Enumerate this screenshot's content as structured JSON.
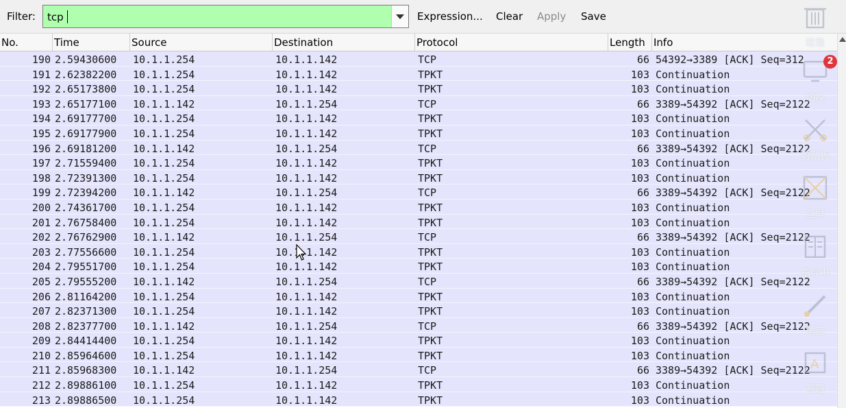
{
  "toolbar": {
    "filter_label": "Filter:",
    "filter_value": "tcp",
    "expression_label": "Expression...",
    "clear_label": "Clear",
    "apply_label": "Apply",
    "save_label": "Save"
  },
  "columns": [
    "No.",
    "Time",
    "Source",
    "Destination",
    "Protocol",
    "Length",
    "Info"
  ],
  "rows": [
    {
      "no": "190",
      "time": "2.59430600",
      "src": "10.1.1.254",
      "dst": "10.1.1.142",
      "proto": "TCP",
      "len": "66",
      "info": "54392→3389 [ACK] Seq=312"
    },
    {
      "no": "191",
      "time": "2.62382200",
      "src": "10.1.1.254",
      "dst": "10.1.1.142",
      "proto": "TPKT",
      "len": "103",
      "info": "Continuation"
    },
    {
      "no": "192",
      "time": "2.65173800",
      "src": "10.1.1.254",
      "dst": "10.1.1.142",
      "proto": "TPKT",
      "len": "103",
      "info": "Continuation"
    },
    {
      "no": "193",
      "time": "2.65177100",
      "src": "10.1.1.142",
      "dst": "10.1.1.254",
      "proto": "TCP",
      "len": "66",
      "info": "3389→54392 [ACK] Seq=2122"
    },
    {
      "no": "194",
      "time": "2.69177700",
      "src": "10.1.1.254",
      "dst": "10.1.1.142",
      "proto": "TPKT",
      "len": "103",
      "info": "Continuation"
    },
    {
      "no": "195",
      "time": "2.69177900",
      "src": "10.1.1.254",
      "dst": "10.1.1.142",
      "proto": "TPKT",
      "len": "103",
      "info": "Continuation"
    },
    {
      "no": "196",
      "time": "2.69181200",
      "src": "10.1.1.142",
      "dst": "10.1.1.254",
      "proto": "TCP",
      "len": "66",
      "info": "3389→54392 [ACK] Seq=2122"
    },
    {
      "no": "197",
      "time": "2.71559400",
      "src": "10.1.1.254",
      "dst": "10.1.1.142",
      "proto": "TPKT",
      "len": "103",
      "info": "Continuation"
    },
    {
      "no": "198",
      "time": "2.72391300",
      "src": "10.1.1.254",
      "dst": "10.1.1.142",
      "proto": "TPKT",
      "len": "103",
      "info": "Continuation"
    },
    {
      "no": "199",
      "time": "2.72394200",
      "src": "10.1.1.142",
      "dst": "10.1.1.254",
      "proto": "TCP",
      "len": "66",
      "info": "3389→54392 [ACK] Seq=2122"
    },
    {
      "no": "200",
      "time": "2.74361700",
      "src": "10.1.1.254",
      "dst": "10.1.1.142",
      "proto": "TPKT",
      "len": "103",
      "info": "Continuation"
    },
    {
      "no": "201",
      "time": "2.76758400",
      "src": "10.1.1.254",
      "dst": "10.1.1.142",
      "proto": "TPKT",
      "len": "103",
      "info": "Continuation"
    },
    {
      "no": "202",
      "time": "2.76762900",
      "src": "10.1.1.142",
      "dst": "10.1.1.254",
      "proto": "TCP",
      "len": "66",
      "info": "3389→54392 [ACK] Seq=2122"
    },
    {
      "no": "203",
      "time": "2.77556600",
      "src": "10.1.1.254",
      "dst": "10.1.1.142",
      "proto": "TPKT",
      "len": "103",
      "info": "Continuation"
    },
    {
      "no": "204",
      "time": "2.79551700",
      "src": "10.1.1.254",
      "dst": "10.1.1.142",
      "proto": "TPKT",
      "len": "103",
      "info": "Continuation"
    },
    {
      "no": "205",
      "time": "2.79555200",
      "src": "10.1.1.142",
      "dst": "10.1.1.254",
      "proto": "TCP",
      "len": "66",
      "info": "3389→54392 [ACK] Seq=2122"
    },
    {
      "no": "206",
      "time": "2.81164200",
      "src": "10.1.1.254",
      "dst": "10.1.1.142",
      "proto": "TPKT",
      "len": "103",
      "info": "Continuation"
    },
    {
      "no": "207",
      "time": "2.82371300",
      "src": "10.1.1.254",
      "dst": "10.1.1.142",
      "proto": "TPKT",
      "len": "103",
      "info": "Continuation"
    },
    {
      "no": "208",
      "time": "2.82377700",
      "src": "10.1.1.142",
      "dst": "10.1.1.254",
      "proto": "TCP",
      "len": "66",
      "info": "3389→54392 [ACK] Seq=2122"
    },
    {
      "no": "209",
      "time": "2.84414400",
      "src": "10.1.1.254",
      "dst": "10.1.1.142",
      "proto": "TPKT",
      "len": "103",
      "info": "Continuation"
    },
    {
      "no": "210",
      "time": "2.85964600",
      "src": "10.1.1.254",
      "dst": "10.1.1.142",
      "proto": "TPKT",
      "len": "103",
      "info": "Continuation"
    },
    {
      "no": "211",
      "time": "2.85968300",
      "src": "10.1.1.142",
      "dst": "10.1.1.254",
      "proto": "TCP",
      "len": "66",
      "info": "3389→54392 [ACK] Seq=2122"
    },
    {
      "no": "212",
      "time": "2.89886100",
      "src": "10.1.1.254",
      "dst": "10.1.1.142",
      "proto": "TPKT",
      "len": "103",
      "info": "Continuation"
    },
    {
      "no": "213",
      "time": "2.89886500",
      "src": "10.1.1.254",
      "dst": "10.1.1.142",
      "proto": "TPKT",
      "len": "103",
      "info": "Continuation"
    }
  ],
  "colors": {
    "filter_valid": "#afffaf",
    "row_tcp": "#e4e4fc"
  },
  "side_panel": [
    {
      "label": "垃圾",
      "icon": "trash-icon"
    },
    {
      "label": "切换",
      "icon": "monitor-icon",
      "badge": "2"
    },
    {
      "label": "剪贴板",
      "icon": "scissors-icon"
    },
    {
      "label": "全屏",
      "icon": "fullscreen-icon"
    },
    {
      "label": "指导书",
      "icon": "book-icon"
    },
    {
      "label": "笔迹",
      "icon": "pen-icon"
    },
    {
      "label": "答题",
      "icon": "answer-icon"
    }
  ]
}
